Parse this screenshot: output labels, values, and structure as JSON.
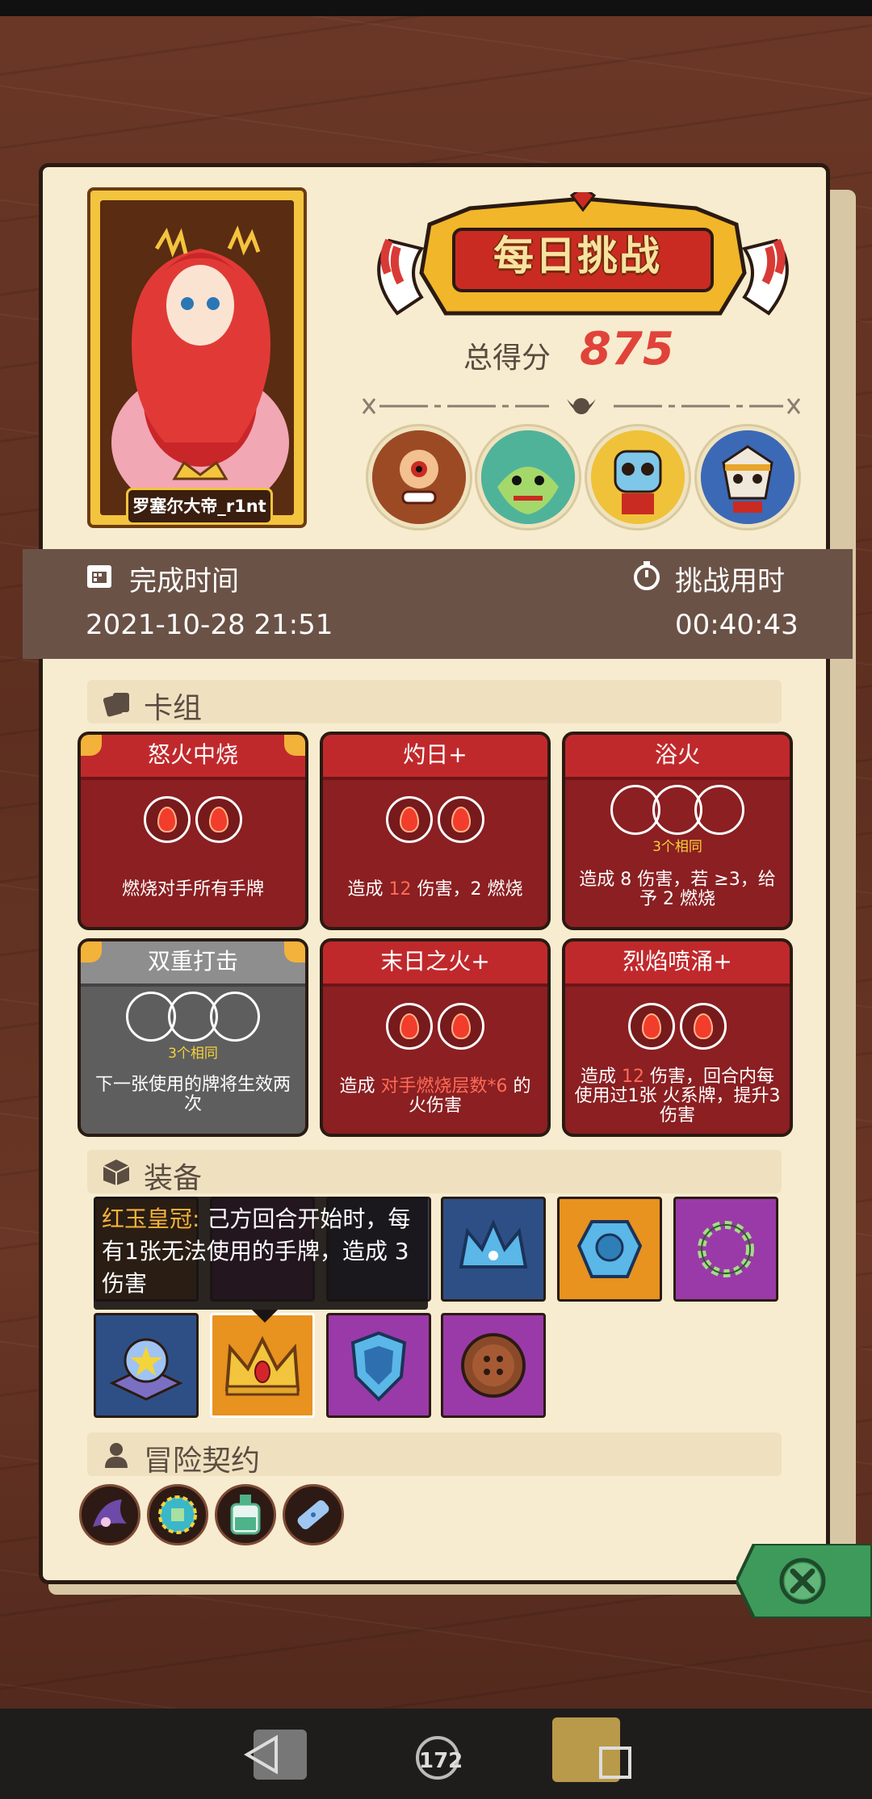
{
  "player": {
    "name": "罗塞尔大帝_r1nt"
  },
  "header": {
    "title": "每日挑战",
    "score_label": "总得分",
    "score_value": "875"
  },
  "bosses": [
    {
      "icon": "cyclops-boss-icon"
    },
    {
      "icon": "dragon-boss-icon"
    },
    {
      "icon": "masked-boss-icon"
    },
    {
      "icon": "skull-knight-boss-icon"
    }
  ],
  "info": {
    "finish_label": "完成时间",
    "finish_value": "2021-10-28 21:51",
    "duration_label": "挑战用时",
    "duration_value": "00:40:43"
  },
  "deck": {
    "title": "卡组",
    "cards": [
      {
        "name": "怒火中烧",
        "desc_pre": "",
        "desc_hl": "",
        "desc": "燃烧对手所有手牌",
        "same": ""
      },
      {
        "name": "灼日+",
        "desc_pre": "造成",
        "desc_hl": "12",
        "desc": "伤害，2 燃烧",
        "same": ""
      },
      {
        "name": "浴火",
        "desc_pre": "",
        "desc_hl": "",
        "desc": "造成 8 伤害，若 ≥3，给予 2 燃烧",
        "same": "3个相同"
      },
      {
        "name": "双重打击",
        "desc_pre": "",
        "desc_hl": "",
        "desc": "下一张使用的牌将生效两次",
        "same": "3个相同"
      },
      {
        "name": "末日之火+",
        "desc_pre": "造成",
        "desc_hl": "对手燃烧层数*6",
        "desc": "的火伤害",
        "same": ""
      },
      {
        "name": "烈焰喷涌+",
        "desc_pre": "造成",
        "desc_hl": "12",
        "desc": "伤害，回合内每使用过1张 火系牌，提升3伤害",
        "same": ""
      }
    ]
  },
  "equipment": {
    "title": "装备",
    "tooltip_name": "红玉皇冠:",
    "tooltip_text": "己方回合开始时，每有1张无法使用的手牌，造成 3伤害"
  },
  "contracts": {
    "title": "冒险契约"
  },
  "nav": {
    "center": "172"
  },
  "colors": {
    "accent": "#e0433a",
    "card_red": "#c0292c",
    "card_gray": "#5e5e5e",
    "panel": "#f7eccf"
  }
}
